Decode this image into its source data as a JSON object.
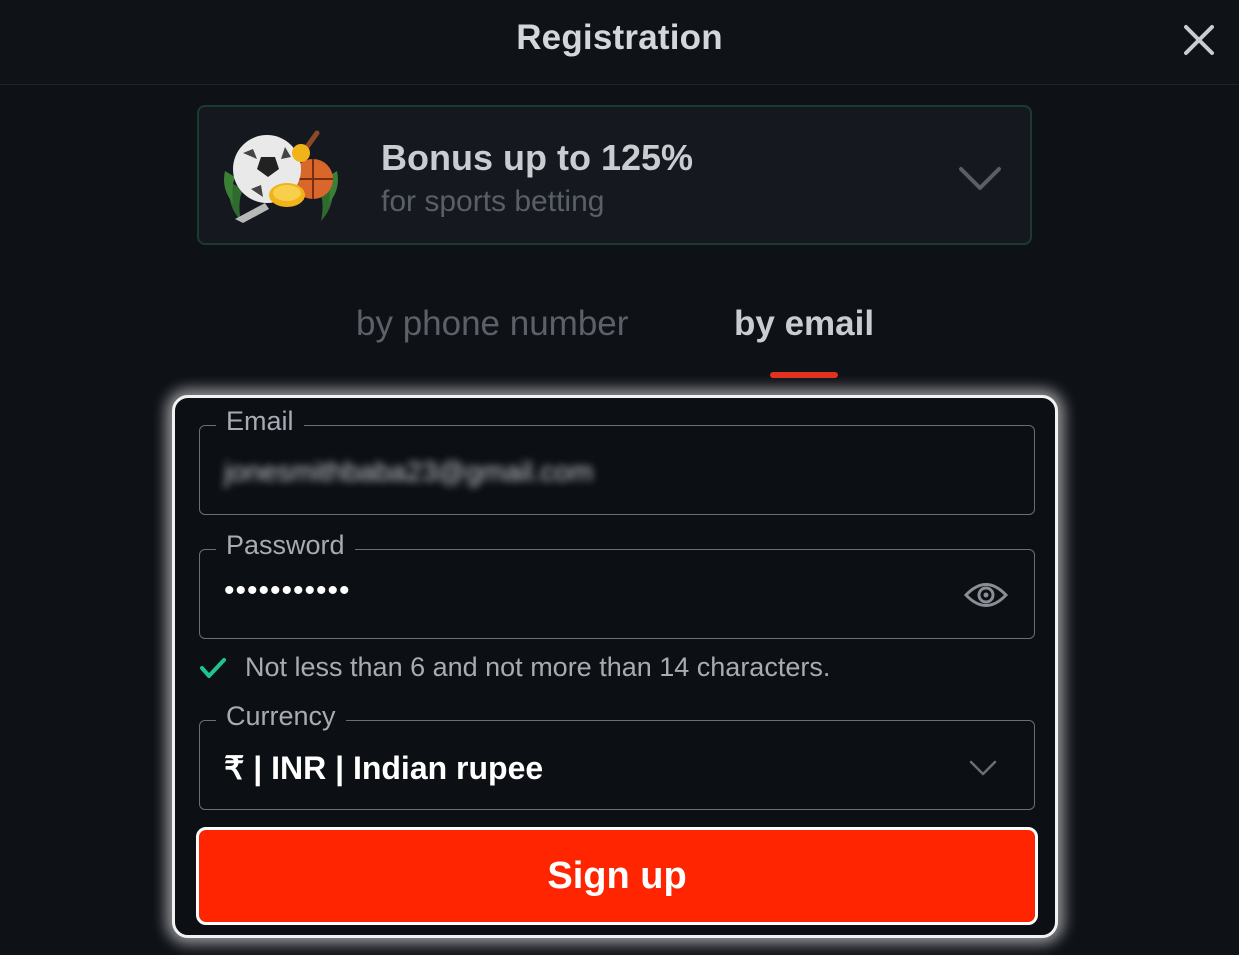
{
  "header": {
    "title": "Registration",
    "close_icon": "close-icon"
  },
  "bonus": {
    "title": "Bonus up to 125%",
    "subtitle": "for sports betting",
    "image_icon": "sports-ball-icon",
    "chevron_icon": "chevron-down-icon"
  },
  "tabs": [
    {
      "label": "by phone number",
      "active": false
    },
    {
      "label": "by email",
      "active": true
    }
  ],
  "form": {
    "email": {
      "label": "Email",
      "value": "jonesmithbaba23@gmail.com"
    },
    "password": {
      "label": "Password",
      "value": "•••••••••••",
      "toggle_icon": "eye-icon"
    },
    "password_hint": {
      "text": "Not less than 6 and not more than 14 characters.",
      "icon": "check-icon"
    },
    "currency": {
      "label": "Currency",
      "value": "₹ | INR | Indian rupee",
      "chevron_icon": "chevron-down-icon"
    },
    "submit_label": "Sign up"
  },
  "colors": {
    "background": "#0e1116",
    "accent": "#ff2500",
    "tab_indicator": "#e0321c",
    "check": "#1fc48a",
    "bonus_border": "#1c3a33"
  }
}
